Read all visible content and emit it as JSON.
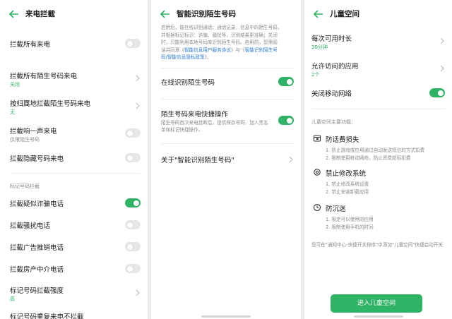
{
  "panel1": {
    "title": "来电拦截",
    "items": [
      {
        "label": "拦截所有来电"
      },
      {
        "label": "拦截所有陌生号码来电",
        "sub": "关闭"
      },
      {
        "label": "按归属地拦截陌生号码来电",
        "sub": "无"
      },
      {
        "label": "拦截响一声来电",
        "sub": "仅限陌生号码"
      },
      {
        "label": "拦截隐藏号码来电"
      }
    ],
    "section_label": "标记号码拦截",
    "marked_items": [
      {
        "label": "拦截疑似诈骗电话"
      },
      {
        "label": "拦截骚扰电话"
      },
      {
        "label": "拦截广告推销电话"
      },
      {
        "label": "拦截房产中介电话"
      },
      {
        "label": "标记号码拦截强度",
        "sub": "高"
      },
      {
        "label": "标记号码重复来电不拦截"
      }
    ]
  },
  "panel2": {
    "title": "智能识别陌生号码",
    "intro_lines": [
      "启用后，能在线识别通话、通话记录、信息中的陌生号码，",
      "并根据标记标识：诈骗、骚扰等，识别结果更准确；关闭",
      "时，只能利用本地号码库识别陌生号码。启用前，您需阅"
    ],
    "intro_line4_pre": "读并同意《",
    "intro_link1": "智能信息用户服务协议",
    "intro_mid": "》与《",
    "intro_link2a": "智能识别陌生号",
    "intro_link2b": "码/智能信息隐私政策",
    "intro_post": "》。",
    "online_label": "在线识别陌生号码",
    "quick_label": "陌生号码来电快捷操作",
    "quick_desc": "陌生号码首次来电挂断后，提供保存号码、加入黑名单和标记快捷操作。",
    "about_label": "关于\"智能识别陌生号码\""
  },
  "panel3": {
    "title": "儿童空间",
    "duration_label": "每次可用时长",
    "duration_value": "30分钟",
    "apps_label": "允许访问的应用",
    "apps_value": "2个",
    "network_label": "关闭移动网络",
    "features_heading": "儿童空间主要功能：",
    "features": [
      {
        "title": "防话费损失",
        "lines": [
          "1. 防止游戏或应用通过自动发送短信的方式扣费",
          "2. 限制使用移动网络，防止资费超标扣费"
        ]
      },
      {
        "title": "禁止修改系统",
        "lines": [
          "1. 禁止修改系统设置",
          "2. 禁止安装卸载应用"
        ]
      },
      {
        "title": "防沉迷",
        "lines": [
          "1. 限定可以使用的应用",
          "2. 限制使用手机的时间"
        ]
      }
    ],
    "note": "您可在\"通知中心-快捷开关排序\"中添加\"儿童空间\"快捷启动开关",
    "enter_button": "进入儿童空间"
  }
}
